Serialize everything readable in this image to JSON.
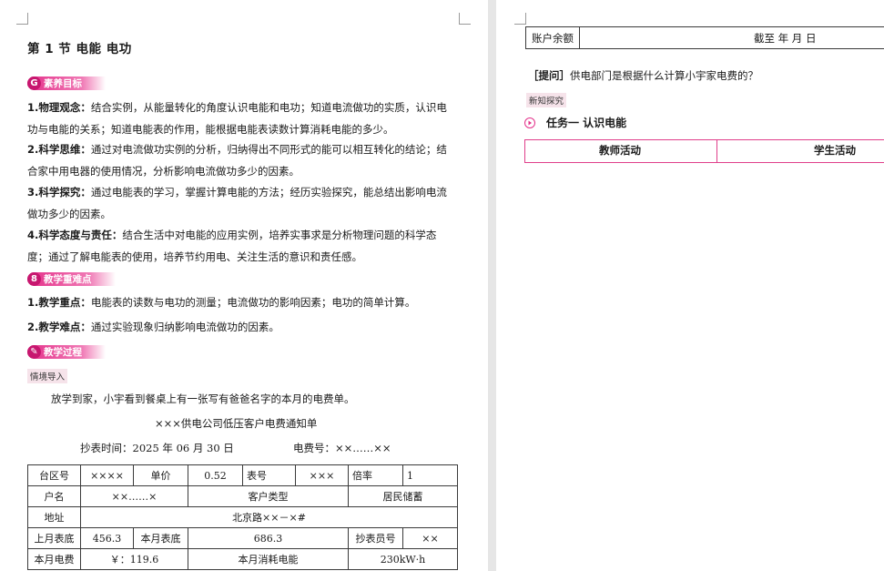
{
  "left_page": {
    "section_title": "第 1 节   电能   电功",
    "objectives_badge": {
      "icon_text": "G",
      "label": "素养目标"
    },
    "objectives": [
      {
        "lead": "1.物理观念：",
        "text": "结合实例，从能量转化的角度认识电能和电功；知道电流做功的实质，认识电功与电能的关系；知道电能表的作用，能根据电能表读数计算消耗电能的多少。"
      },
      {
        "lead": "2.科学思维：",
        "text": "通过对电流做功实例的分析，归纳得出不同形式的能可以相互转化的结论；结合家中用电器的使用情况，分析影响电流做功多少的因素。"
      },
      {
        "lead": "3.科学探究：",
        "text": "通过电能表的学习，掌握计算电能的方法；经历实验探究，能总结出影响电流做功多少的因素。"
      },
      {
        "lead": "4.科学态度与责任：",
        "text": "结合生活中对电能的应用实例，培养实事求是分析物理问题的科学态度；通过了解电能表的使用，培养节约用电、关注生活的意识和责任感。"
      }
    ],
    "keypoints_badge": {
      "icon_text": "8",
      "label": "教学重难点"
    },
    "keypoints": [
      {
        "lead": "1.教学重点：",
        "text": "电能表的读数与电功的测量；电流做功的影响因素；电功的简单计算。"
      },
      {
        "lead": "2.教学难点：",
        "text": "通过实验现象归纳影响电流做功的因素。"
      }
    ],
    "process_badge": {
      "icon_text": "✎",
      "label": "教学过程"
    },
    "intro_tag": "情境导入",
    "intro_text": "放学到家，小宇看到餐桌上有一张写有爸爸名字的本月的电费单。",
    "bill_title": "×××供电公司低压客户电费通知单",
    "bill_date": "抄表时间：2025 年 06 月 30 日",
    "bill_number": "电费号：××……××",
    "bill_table": {
      "r1": [
        "台区号",
        "××××",
        "单价",
        "0.52",
        "表号",
        "×××",
        "倍率",
        "1"
      ],
      "r2": [
        "户名",
        "××……×",
        "客户类型",
        "居民储蓄"
      ],
      "r3": [
        "地址",
        "北京路××－×#"
      ],
      "r4": [
        "上月表底",
        "456.3",
        "本月表底",
        "686.3",
        "抄表员号",
        "××"
      ],
      "r5": [
        "本月电费",
        "￥：119.6",
        "本月消耗电能",
        "230kW·h"
      ]
    }
  },
  "right_page": {
    "balance_label": "账户余额",
    "balance_date": "截至      年      月      日",
    "question_lead": "［提问］",
    "question_text": "供电部门是根据什么计算小宇家电费的？",
    "explore_tag": "新知探究",
    "task_title": "任务一   认识电能",
    "activity_headers": [
      "教师活动",
      "学生活动"
    ]
  },
  "colors": {
    "accent": "#e4318a",
    "badge_dark": "#c7176f",
    "tag_bg": "#f6e3ea"
  }
}
